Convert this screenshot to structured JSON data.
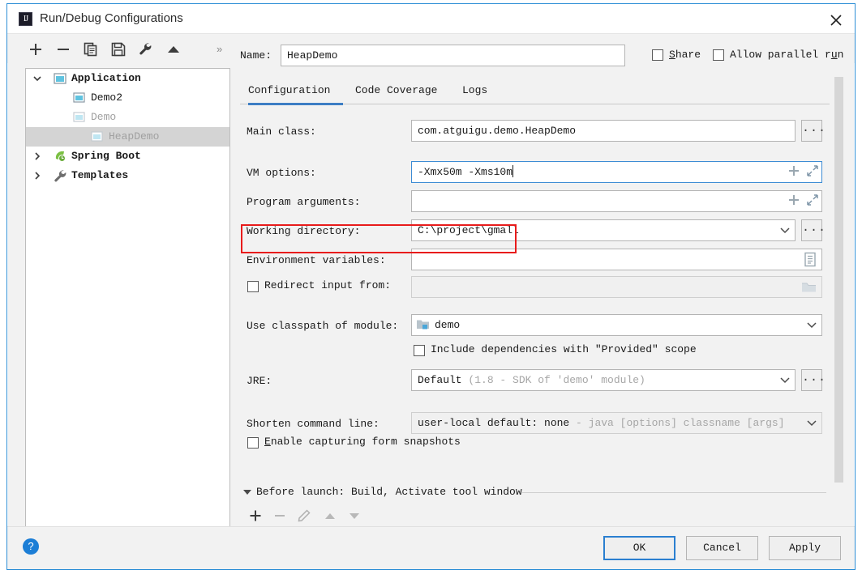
{
  "window": {
    "title": "Run/Debug Configurations",
    "app_icon": "intellij-idea-icon",
    "close_icon": "close-icon"
  },
  "toolbar": {
    "buttons": [
      {
        "name": "add-configuration-button",
        "icon": "plus-icon"
      },
      {
        "name": "remove-configuration-button",
        "icon": "minus-icon"
      },
      {
        "name": "copy-configuration-button",
        "icon": "copy-icon"
      },
      {
        "name": "save-configuration-button",
        "icon": "save-icon"
      },
      {
        "name": "edit-templates-button",
        "icon": "wrench-icon"
      },
      {
        "name": "move-up-button",
        "icon": "arrow-up-icon"
      }
    ],
    "overflow_label": "»"
  },
  "tree": {
    "items": [
      {
        "label": "Application",
        "icon": "application-icon",
        "twisty": "chevron-down",
        "depth": 0,
        "state": "bold",
        "selected": false
      },
      {
        "label": "Demo2",
        "icon": "run-config-icon",
        "twisty": "",
        "depth": 1,
        "state": "normal",
        "selected": false
      },
      {
        "label": "Demo",
        "icon": "run-config-icon-dim",
        "twisty": "",
        "depth": 1,
        "state": "dim",
        "selected": false
      },
      {
        "label": "HeapDemo",
        "icon": "run-config-icon-dim",
        "twisty": "",
        "depth": 2,
        "state": "dim",
        "selected": true
      },
      {
        "label": "Spring Boot",
        "icon": "spring-boot-icon",
        "twisty": "chevron-right",
        "depth": 0,
        "state": "bold",
        "selected": false
      },
      {
        "label": "Templates",
        "icon": "wrench-icon",
        "twisty": "chevron-right",
        "depth": 0,
        "state": "bold",
        "selected": false
      }
    ]
  },
  "header": {
    "name_label": "Name:",
    "name_value": "HeapDemo",
    "share_label": "Share",
    "share_checked": false,
    "allow_parallel_label": "Allow parallel run",
    "allow_parallel_checked": false
  },
  "tabs": [
    {
      "label": "Configuration",
      "active": true
    },
    {
      "label": "Code Coverage",
      "active": false
    },
    {
      "label": "Logs",
      "active": false
    }
  ],
  "form": {
    "main_class_label": "Main class:",
    "main_class_value": "com.atguigu.demo.HeapDemo",
    "main_class_browse": "...",
    "vm_options_label": "VM options:",
    "vm_options_value": "-Xmx50m -Xms10m",
    "vm_options_focused": true,
    "program_arguments_label": "Program arguments:",
    "program_arguments_value": "",
    "working_directory_label": "Working directory:",
    "working_directory_value": "C:\\project\\gmall",
    "working_directory_browse": "...",
    "environment_variables_label": "Environment variables:",
    "environment_variables_value": "",
    "redirect_input_label": "Redirect input from:",
    "redirect_input_checked": false,
    "redirect_input_value": "",
    "use_classpath_label": "Use classpath of module:",
    "use_classpath_value": "demo",
    "include_dependencies_label": "Include dependencies with \"Provided\" scope",
    "include_dependencies_checked": false,
    "jre_label": "JRE:",
    "jre_value": "Default",
    "jre_value_hint": "(1.8 - SDK of 'demo' module)",
    "jre_browse": "...",
    "shorten_command_label": "Shorten command line:",
    "shorten_command_value": "user-local default: none",
    "shorten_command_hint": "- java [options] classname [args]",
    "enable_snapshots_label": "Enable capturing form snapshots",
    "enable_snapshots_checked": false
  },
  "before_launch": {
    "title": "Before launch: Build, Activate tool window",
    "buttons": [
      {
        "name": "before-launch-add-button",
        "icon": "plus-icon"
      },
      {
        "name": "before-launch-remove-button",
        "icon": "minus-icon"
      },
      {
        "name": "before-launch-edit-button",
        "icon": "pencil-icon"
      },
      {
        "name": "before-launch-move-up-button",
        "icon": "arrow-up-icon"
      },
      {
        "name": "before-launch-move-down-button",
        "icon": "arrow-down-icon"
      }
    ]
  },
  "footer": {
    "help_label": "?",
    "ok_label": "OK",
    "cancel_label": "Cancel",
    "apply_label": "Apply"
  },
  "annotation": {
    "color": "#e81b1b",
    "target": "vm-options-row"
  },
  "colors": {
    "accent_blue": "#3d7ec4",
    "focus_blue": "#2b7fd0",
    "selection_gray": "#d4d4d4",
    "annotation_red": "#e81b1b"
  }
}
